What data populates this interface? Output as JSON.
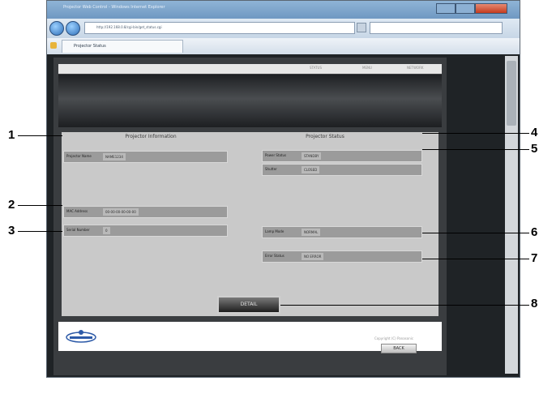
{
  "browser": {
    "window_title": "Projector Web Control - Windows Internet Explorer",
    "url": "http://192.168.0.8/cgi-bin/get_status.cgi",
    "tab_title": "Projector Status"
  },
  "page": {
    "header_links": [
      "STATUS",
      "MENU",
      "NETWORK"
    ],
    "projector_information": {
      "title": "Projector Information",
      "projector_name": {
        "label": "Projector Name",
        "value": "NAME1234"
      },
      "mac_address": {
        "label": "MAC Address",
        "value": "00-00-00-00-00-00"
      },
      "serial_number": {
        "label": "Serial Number",
        "value": "0"
      }
    },
    "projector_status": {
      "title": "Projector Status",
      "power_status": {
        "label": "Power Status",
        "value": "STANDBY"
      },
      "shutter": {
        "label": "Shutter",
        "value": "CLOSED"
      },
      "lamp_mode": {
        "label": "Lamp Mode",
        "value": "NORMAL"
      },
      "error_status": {
        "label": "Error Status",
        "value": "NO ERROR"
      }
    },
    "detail_button": "DETAIL",
    "copyright": "Copyright (C) Panasonic",
    "back_button": "BACK"
  },
  "callouts": [
    "1",
    "2",
    "3",
    "4",
    "5",
    "6",
    "7",
    "8"
  ]
}
